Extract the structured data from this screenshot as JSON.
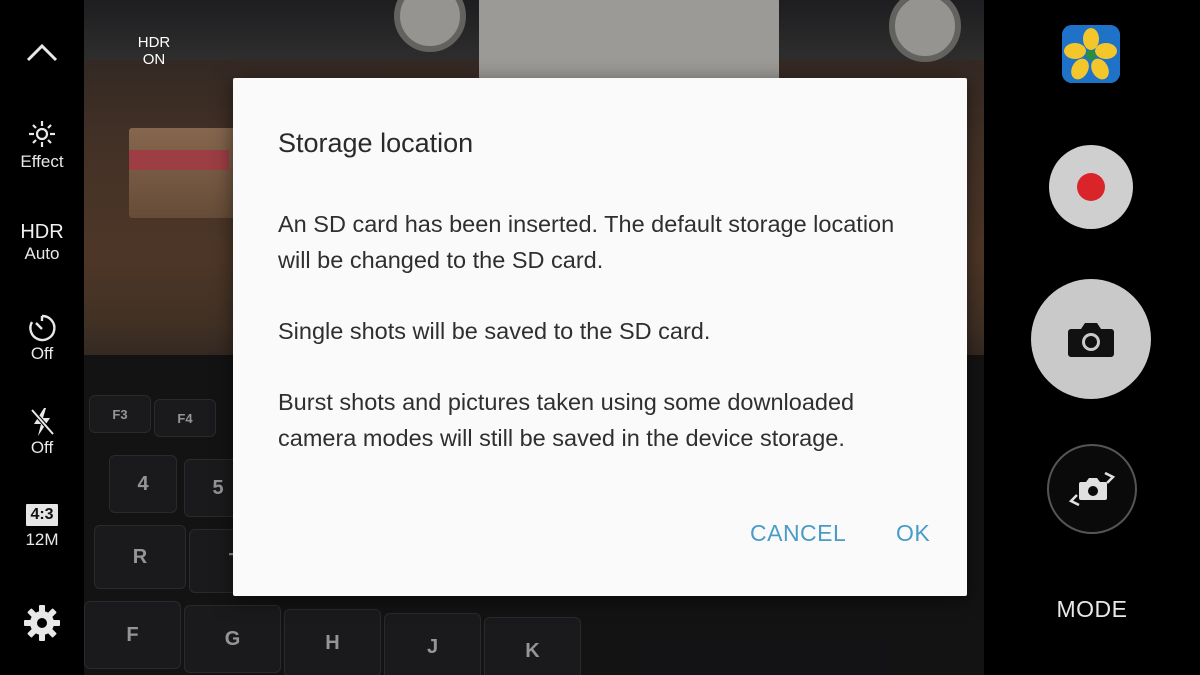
{
  "sidebar": {
    "effect_label": "Effect",
    "hdr_label": "HDR",
    "hdr_value": "Auto",
    "timer_value": "Off",
    "flash_value": "Off",
    "ratio_label": "4:3",
    "resolution_label": "12M"
  },
  "viewfinder": {
    "hdr_indicator_line1": "HDR",
    "hdr_indicator_line2": "ON"
  },
  "right_controls": {
    "mode_label": "MODE"
  },
  "dialog": {
    "title": "Storage location",
    "paragraphs": [
      "An SD card has been inserted. The default storage location will be changed to the SD card.",
      "Single shots will be saved to the SD card.",
      "Burst shots and pictures taken using some downloaded camera modes will still be saved in the device storage."
    ],
    "cancel_label": "CANCEL",
    "ok_label": "OK"
  },
  "colors": {
    "accent": "#4a9cc8",
    "record_red": "#d9252a",
    "dialog_bg": "#fafafa"
  },
  "keyboard_keys": [
    "F3",
    "F4",
    "$",
    "4",
    "%",
    "5",
    "R",
    "T",
    "F",
    "G",
    "H",
    "J",
    "K"
  ]
}
